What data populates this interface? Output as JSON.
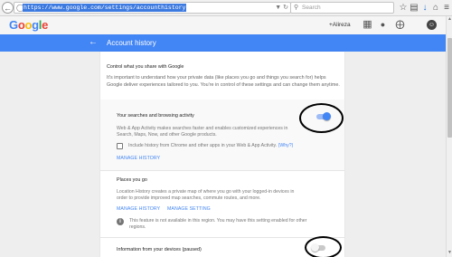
{
  "browser": {
    "url": "https://www.google.com/settings/accounthistory",
    "search_placeholder": "Search"
  },
  "header": {
    "logo": [
      "G",
      "o",
      "o",
      "g",
      "l",
      "e"
    ],
    "logo_colors": [
      "#4285f4",
      "#ea4335",
      "#fbbc05",
      "#4285f4",
      "#34a853",
      "#ea4335"
    ],
    "user": "+Alireza"
  },
  "title_bar": {
    "title": "Account history",
    "color": "#4285f4"
  },
  "page": {
    "heading": "Control what you share with Google",
    "intro": "It's important to understand how your private data (like places you go and things you search for) helps Google deliver experiences tailored to you. You're in control of these settings and can change them anytime."
  },
  "sections": {
    "web_activity": {
      "title": "Your searches and browsing activity",
      "description": "Web & App Activity makes searches faster and enables customized experiences in Search, Maps, Now, and other Google products.",
      "checkbox_label": "Include history from Chrome and other apps in your Web & App Activity.",
      "why_link": "(Why?)",
      "manage_link": "MANAGE HISTORY",
      "toggle_on": true
    },
    "places": {
      "title": "Places you go",
      "description": "Location History creates a private map of where you go with your logged-in devices in order to provide improved map searches, commute routes, and more.",
      "manage_history_link": "MANAGE HISTORY",
      "manage_setting_link": "MANAGE SETTING",
      "info_text": "This feature is not available in this region. You may have this setting enabled for other regions."
    },
    "devices": {
      "title": "Information from your devices (paused)",
      "toggle_on": false
    }
  },
  "icons": {
    "back": "back-arrow-icon",
    "apps": "apps-grid-icon",
    "notifications": "notifications-icon",
    "share": "share-icon",
    "info": "info-icon"
  },
  "colors": {
    "accent": "#4285f4",
    "toggle_on_track": "#9dbbf6",
    "toggle_off_track": "#c9c9c9"
  }
}
